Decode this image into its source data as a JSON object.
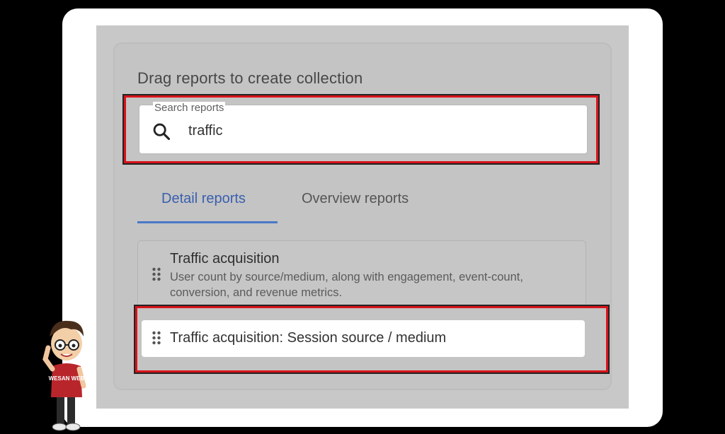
{
  "panel": {
    "heading": "Drag reports to create collection"
  },
  "search": {
    "label": "Search reports",
    "value": "traffic",
    "icon": "search-icon"
  },
  "tabs": [
    {
      "label": "Detail reports",
      "active": true
    },
    {
      "label": "Overview reports",
      "active": false
    }
  ],
  "reports": [
    {
      "title": "Traffic acquisition",
      "description": "User count by source/medium, along with engagement, event-count, conversion, and revenue metrics."
    },
    {
      "title": "Traffic acquisition: Session source / medium"
    }
  ],
  "mascot": {
    "shirt_text": "WESAN WEB"
  },
  "colors": {
    "highlight": "#d7141b",
    "active_tab": "#3a5fae",
    "background": "#c8c8c8"
  }
}
